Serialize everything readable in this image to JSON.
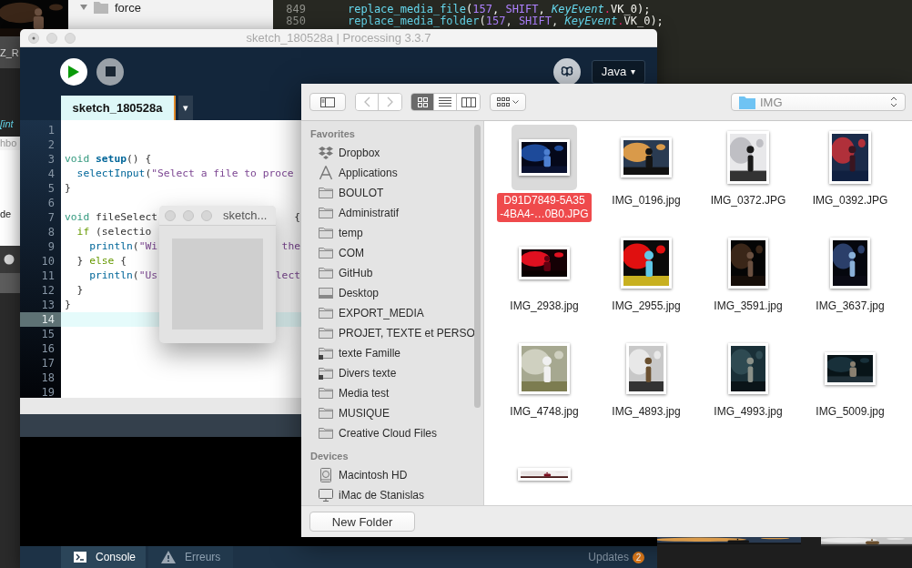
{
  "background": {
    "finder_rows": [
      {
        "label": "force",
        "expanded": true
      }
    ],
    "editor_lines": [
      {
        "number": "849",
        "tokens": [
          {
            "text": "replace_media_file",
            "kind": "function"
          },
          {
            "text": "(",
            "kind": "plain"
          },
          {
            "text": "157",
            "kind": "constant"
          },
          {
            "text": ", ",
            "kind": "plain"
          },
          {
            "text": "SHIFT",
            "kind": "constant"
          },
          {
            "text": ", ",
            "kind": "plain"
          },
          {
            "text": "KeyEvent",
            "kind": "type"
          },
          {
            "text": ".",
            "kind": "operator"
          },
          {
            "text": "VK_0",
            "kind": "plain"
          },
          {
            "text": ");",
            "kind": "plain"
          }
        ]
      },
      {
        "number": "850",
        "tokens": [
          {
            "text": "replace_media_folder",
            "kind": "function"
          },
          {
            "text": "(",
            "kind": "plain"
          },
          {
            "text": "157",
            "kind": "constant"
          },
          {
            "text": ", ",
            "kind": "plain"
          },
          {
            "text": "SHIFT",
            "kind": "constant"
          },
          {
            "text": ", ",
            "kind": "plain"
          },
          {
            "text": "KeyEvent",
            "kind": "type"
          },
          {
            "text": ".",
            "kind": "operator"
          },
          {
            "text": "VK_0",
            "kind": "plain"
          },
          {
            "text": ");",
            "kind": "plain"
          }
        ]
      }
    ],
    "side_fragments": {
      "tab": "Z_R",
      "code": "[int",
      "field": "hbo",
      "text": "de"
    }
  },
  "processing": {
    "title": "sketch_180528a | Processing 3.3.7",
    "mode": "Java",
    "mode_caret": "▾",
    "tabs": [
      {
        "label": "sketch_180528a",
        "selected": true
      }
    ],
    "tab_menu": "▾",
    "lines": [
      {
        "number": "1",
        "current": false
      },
      {
        "number": "2",
        "current": false
      },
      {
        "number": "3",
        "current": false,
        "tokens": [
          {
            "text": "void ",
            "kind": "keyword"
          },
          {
            "text": "setup",
            "kind": "definition"
          },
          {
            "text": "() {",
            "kind": "plain"
          }
        ]
      },
      {
        "number": "4",
        "current": false,
        "tokens": [
          {
            "text": "  selectInput",
            "kind": "function"
          },
          {
            "text": "(",
            "kind": "plain"
          },
          {
            "text": "\"Select a file to proce",
            "kind": "string"
          }
        ]
      },
      {
        "number": "5",
        "current": false,
        "tokens": [
          {
            "text": "}",
            "kind": "plain"
          }
        ]
      },
      {
        "number": "6",
        "current": false
      },
      {
        "number": "7",
        "current": false,
        "tokens": [
          {
            "text": "void",
            "kind": "keyword"
          },
          {
            "text": " fileSelect",
            "kind": "plain"
          }
        ],
        "tail": [
          {
            "text": "{",
            "kind": "plain"
          }
        ]
      },
      {
        "number": "8",
        "current": false,
        "tokens": [
          {
            "text": "  if",
            "kind": "control"
          },
          {
            "text": " (selectio",
            "kind": "plain"
          }
        ]
      },
      {
        "number": "9",
        "current": false,
        "tokens": [
          {
            "text": "    println",
            "kind": "function"
          },
          {
            "text": "(",
            "kind": "plain"
          },
          {
            "text": "\"Wi",
            "kind": "string"
          }
        ],
        "tail": [
          {
            "text": "the",
            "kind": "string"
          }
        ]
      },
      {
        "number": "10",
        "current": false,
        "tokens": [
          {
            "text": "  } ",
            "kind": "plain"
          },
          {
            "text": "else",
            "kind": "control"
          },
          {
            "text": " {",
            "kind": "plain"
          }
        ]
      },
      {
        "number": "11",
        "current": false,
        "tokens": [
          {
            "text": "    println",
            "kind": "function"
          },
          {
            "text": "(",
            "kind": "plain"
          },
          {
            "text": "\"Us",
            "kind": "string"
          }
        ],
        "tail": [
          {
            "text": "lect",
            "kind": "string"
          }
        ]
      },
      {
        "number": "12",
        "current": false,
        "tokens": [
          {
            "text": "  }",
            "kind": "plain"
          }
        ]
      },
      {
        "number": "13",
        "current": false,
        "tokens": [
          {
            "text": "}",
            "kind": "plain"
          }
        ]
      },
      {
        "number": "14",
        "current": true
      },
      {
        "number": "15",
        "current": false
      },
      {
        "number": "16",
        "current": false
      },
      {
        "number": "17",
        "current": false
      },
      {
        "number": "18",
        "current": false
      },
      {
        "number": "19",
        "current": false
      }
    ],
    "status_tabs": [
      {
        "label": "Console",
        "selected": true,
        "kind": "console"
      },
      {
        "label": "Erreurs",
        "selected": false,
        "kind": "errors"
      }
    ],
    "updates": {
      "label": "Updates",
      "count": "2"
    }
  },
  "sketch_window": {
    "title": "sketch..."
  },
  "dialog": {
    "view_modes": [
      {
        "kind": "icons",
        "selected": true
      },
      {
        "kind": "list",
        "selected": false
      },
      {
        "kind": "columns",
        "selected": false
      }
    ],
    "location": "IMG",
    "sidebar": [
      {
        "heading": "Favorites",
        "items": [
          {
            "label": "Dropbox",
            "kind": "dropbox"
          },
          {
            "label": "Applications",
            "kind": "apps"
          },
          {
            "label": "BOULOT",
            "kind": "folder"
          },
          {
            "label": "Administratif",
            "kind": "folder"
          },
          {
            "label": "temp",
            "kind": "folder"
          },
          {
            "label": "COM",
            "kind": "folder"
          },
          {
            "label": "GitHub",
            "kind": "folder"
          },
          {
            "label": "Desktop",
            "kind": "desktop"
          },
          {
            "label": "EXPORT_MEDIA",
            "kind": "folder"
          },
          {
            "label": "PROJET, TEXTE et PERSO",
            "kind": "folder"
          },
          {
            "label": "texte Famille",
            "kind": "folder_badge"
          },
          {
            "label": "Divers texte",
            "kind": "folder_badge"
          },
          {
            "label": "Media test",
            "kind": "folder"
          },
          {
            "label": "MUSIQUE",
            "kind": "folder"
          },
          {
            "label": "Creative Cloud Files",
            "kind": "folder"
          }
        ]
      },
      {
        "heading": "Devices",
        "items": [
          {
            "label": "Macintosh HD",
            "kind": "disk"
          },
          {
            "label": "iMac de Stanislas",
            "kind": "computer"
          }
        ]
      }
    ],
    "files": [
      {
        "name_lines": [
          "D91D7849-5A35",
          "-4BA4-…0B0.JPG"
        ],
        "selected": true
      },
      {
        "name_lines": [
          "IMG_0196.jpg"
        ],
        "selected": false
      },
      {
        "name_lines": [
          "IMG_0372.JPG"
        ],
        "selected": false
      },
      {
        "name_lines": [
          "IMG_0392.JPG"
        ],
        "selected": false
      },
      {
        "name_lines": [
          "IMG_2938.jpg"
        ],
        "selected": false
      },
      {
        "name_lines": [
          "IMG_2955.jpg"
        ],
        "selected": false
      },
      {
        "name_lines": [
          "IMG_3591.jpg"
        ],
        "selected": false
      },
      {
        "name_lines": [
          "IMG_3637.jpg"
        ],
        "selected": false
      },
      {
        "name_lines": [
          "IMG_4748.jpg"
        ],
        "selected": false
      },
      {
        "name_lines": [
          "IMG_4893.jpg"
        ],
        "selected": false
      },
      {
        "name_lines": [
          "IMG_4993.jpg"
        ],
        "selected": false
      },
      {
        "name_lines": [
          "IMG_5009.jpg"
        ],
        "selected": false
      },
      {
        "selected": false
      }
    ],
    "button": "New Folder"
  }
}
